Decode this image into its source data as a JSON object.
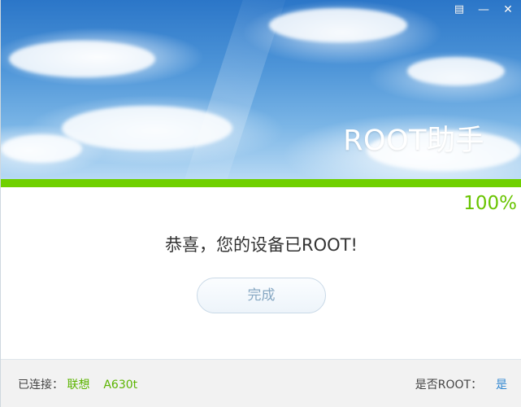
{
  "window": {
    "title": "ROOT助手",
    "controls": {
      "menu_icon": "menu-icon",
      "minimize_icon": "minimize-icon",
      "close_icon": "close-icon"
    }
  },
  "progress": {
    "value": 1.0,
    "label": "100%",
    "fill_color": "#6fd000",
    "text_color": "#69c400"
  },
  "status": {
    "message": "恭喜，您的设备已ROOT!"
  },
  "actions": {
    "done_label": "完成"
  },
  "footer": {
    "connection_label": "已连接：",
    "brand": "联想",
    "model": "A630t",
    "root_label": "是否ROOT：",
    "root_value": "是"
  },
  "colors": {
    "accent_green": "#6fd000",
    "accent_blue": "#2f86d1",
    "button_text": "#87a8c3"
  }
}
